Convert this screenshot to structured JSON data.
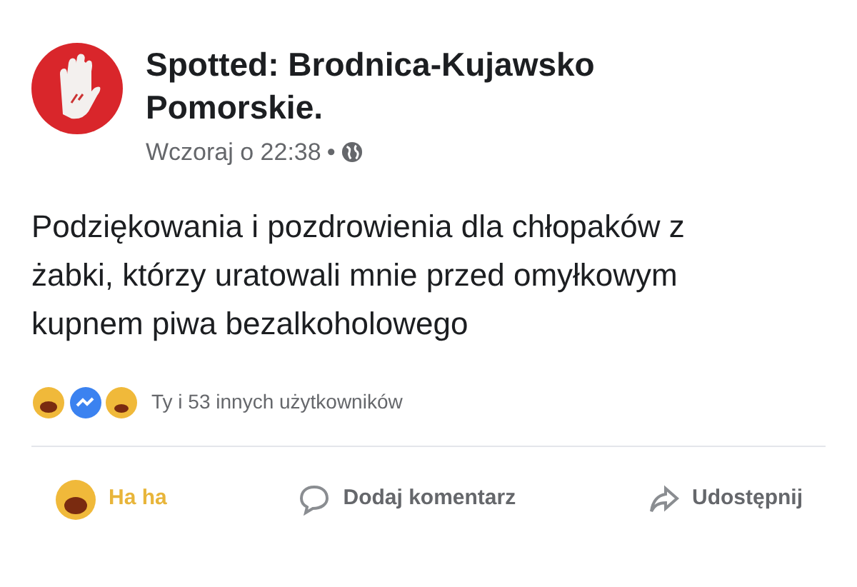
{
  "post": {
    "author": "Spotted: Brodnica-Kujawsko Pomorskie.",
    "time": "Wczoraj o 22:38",
    "separator": "•",
    "text": "Podziękowania i pozdrowienia dla chłopaków z żabki, którzy uratowali mnie przed omyłkowym kupnem piwa bezalkoholowego"
  },
  "reactions": {
    "summary": "Ty i 53 innych użytkowników"
  },
  "actions": [
    {
      "kind": "haha",
      "label": "Ha ha",
      "selected": true
    },
    {
      "kind": "comment",
      "label": "Dodaj komentarz",
      "selected": false
    },
    {
      "kind": "share",
      "label": "Udostępnij",
      "selected": false
    }
  ]
}
